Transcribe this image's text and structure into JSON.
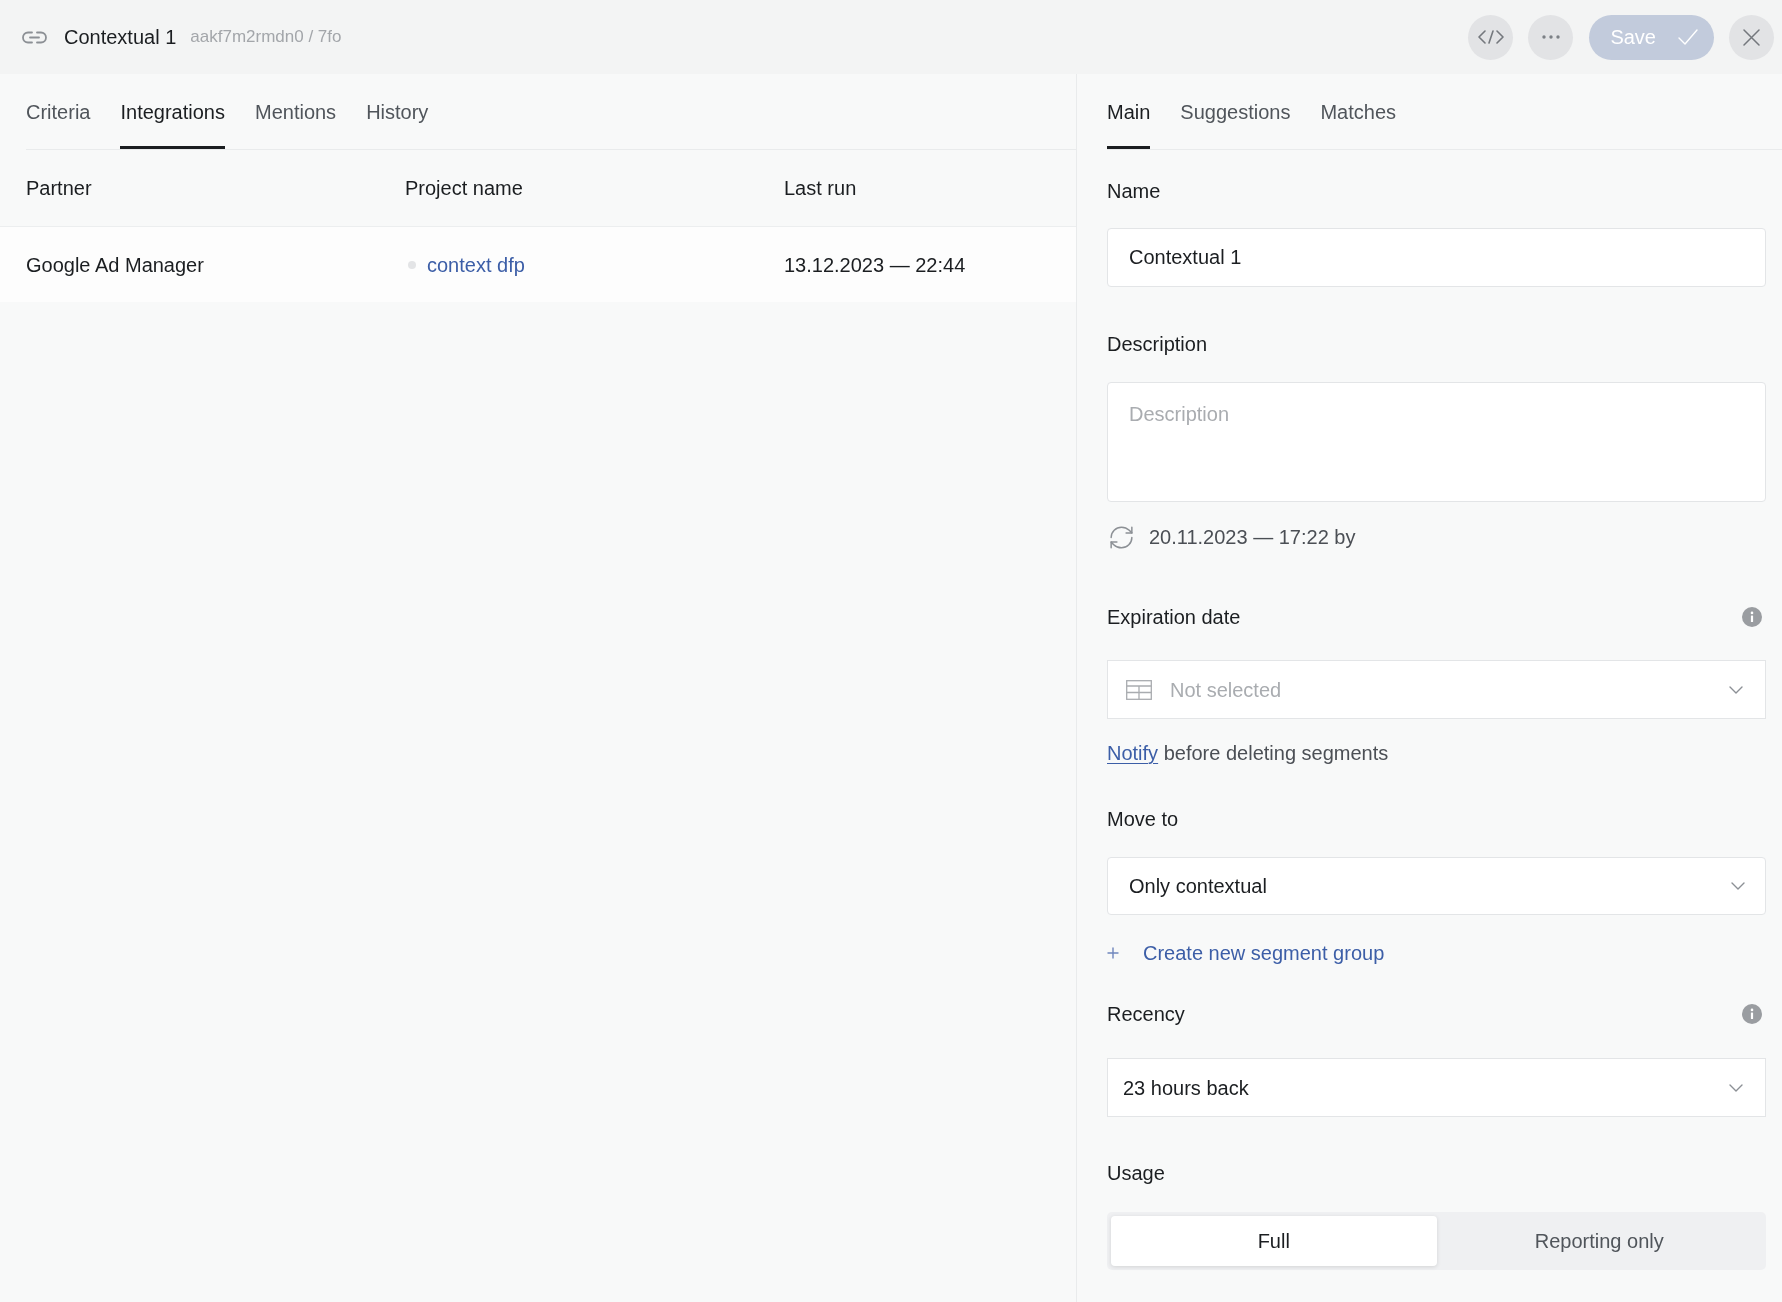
{
  "header": {
    "title": "Contextual 1",
    "subtitle": "aakf7m2rmdn0 / 7fo",
    "save_button": {
      "label": "Save",
      "disabled": true
    }
  },
  "left_panel": {
    "tabs": [
      {
        "label": "Criteria",
        "selected": false
      },
      {
        "label": "Integrations",
        "selected": true
      },
      {
        "label": "Mentions",
        "selected": false
      },
      {
        "label": "History",
        "selected": false
      }
    ],
    "table": {
      "columns": [
        "Partner",
        "Project name",
        "Last run"
      ],
      "rows": [
        {
          "partner": "Google Ad Manager",
          "project_name": "context dfp",
          "color": "#e3e4e6",
          "last_run": "13.12.2023 — 22:44"
        }
      ]
    }
  },
  "right_panel": {
    "tabs": [
      {
        "label": "Main",
        "selected": true
      },
      {
        "label": "Suggestions",
        "selected": false
      },
      {
        "label": "Matches",
        "selected": false
      }
    ],
    "form": {
      "name": {
        "label": "Name",
        "value": "Contextual 1"
      },
      "description": {
        "label": "Description",
        "placeholder": "Description"
      },
      "updated": "20.11.2023 — 17:22 by",
      "expiration_date": {
        "label": "Expiration date",
        "placeholder": "Not selected"
      },
      "notify": {
        "link": "Notify",
        "text": "before deleting segments"
      },
      "move_to": {
        "label": "Move to",
        "value": "Only contextual"
      },
      "create_group": "Create new segment group",
      "recency": {
        "label": "Recency",
        "value": "23 hours back"
      },
      "usage": {
        "label": "Usage",
        "options": [
          {
            "label": "Full",
            "selected": true
          },
          {
            "label": "Reporting only",
            "selected": false
          }
        ]
      }
    }
  }
}
